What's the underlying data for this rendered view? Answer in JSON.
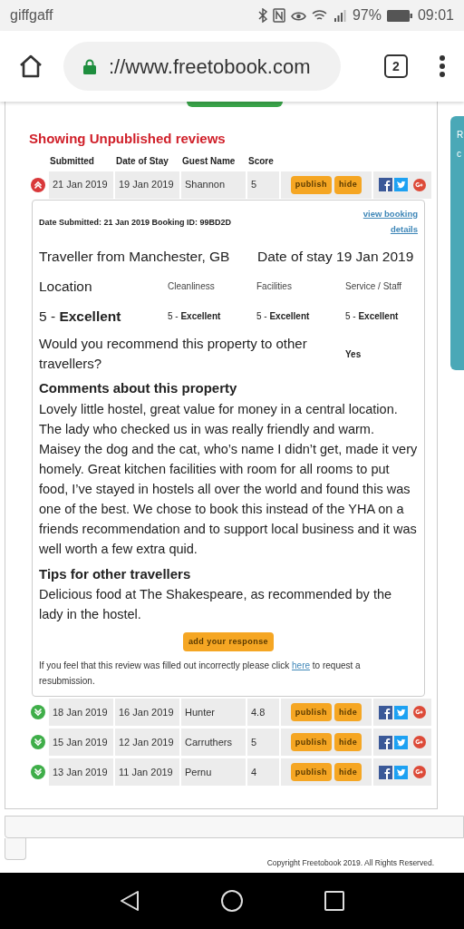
{
  "status_bar": {
    "carrier": "giffgaff",
    "battery": "97%",
    "time": "09:01"
  },
  "browser": {
    "url": "://www.freetobook.com",
    "tab_count": "2"
  },
  "side_panel": {
    "text_1": "R",
    "text_2": "c"
  },
  "heading": "Showing Unpublished reviews",
  "table": {
    "columns": [
      "Submitted",
      "Date of Stay",
      "Guest Name",
      "Score"
    ],
    "rows": [
      {
        "submitted": "21 Jan 2019",
        "date_of_stay": "19 Jan 2019",
        "guest": "Shannon",
        "score": "5",
        "expanded": true,
        "publish": "publish",
        "hide": "hide"
      },
      {
        "submitted": "18 Jan 2019",
        "date_of_stay": "16 Jan 2019",
        "guest": "Hunter",
        "score": "4.8",
        "expanded": false,
        "publish": "publish",
        "hide": "hide"
      },
      {
        "submitted": "15 Jan 2019",
        "date_of_stay": "12 Jan 2019",
        "guest": "Carruthers",
        "score": "5",
        "expanded": false,
        "publish": "publish",
        "hide": "hide"
      },
      {
        "submitted": "13 Jan 2019",
        "date_of_stay": "11 Jan 2019",
        "guest": "Pernu",
        "score": "4",
        "expanded": false,
        "publish": "publish",
        "hide": "hide"
      }
    ]
  },
  "detail": {
    "meta": "Date Submitted: 21 Jan 2019  Booking ID: 99BD2D",
    "view_booking": "view booking details",
    "traveller": "Traveller from Manchester, GB",
    "stay": "Date of stay 19 Jan 2019",
    "ratings": [
      {
        "label": "Location",
        "value": "5 - **Excellent**"
      },
      {
        "label": "Cleanliness",
        "value": "5 - **Excellent**"
      },
      {
        "label": "Facilities",
        "value": "5 - **Excellent**"
      },
      {
        "label": "Service / Staff",
        "value": "5 - **Excellent**"
      }
    ],
    "recommend_question": "Would you recommend this property to other travellers?",
    "recommend_answer": "Yes",
    "comments_title": "Comments about this property",
    "comments": "Lovely little hostel, great value for money in a central location. The lady who checked us in was really friendly and warm. Maisey the dog and the cat, who’s name I didn’t get, made it very homely. Great kitchen facilities with room for all rooms to put food, I’ve stayed in hostels all over the world and found this was one of the best. We chose to book this instead of the YHA on a friends recommendation and to support local business and it was well worth a few extra quid.",
    "tips_title": "Tips for other travellers",
    "tips": "Delicious food at The Shakespeare, as recommended by the lady in the hostel.",
    "response_button": "add your response",
    "note_before": "If you feel that this review was filled out incorrectly please click",
    "note_link": "here",
    "note_after": "to request a resubmission."
  },
  "footer": "Copyright Freetobook 2019. All Rights Reserved."
}
